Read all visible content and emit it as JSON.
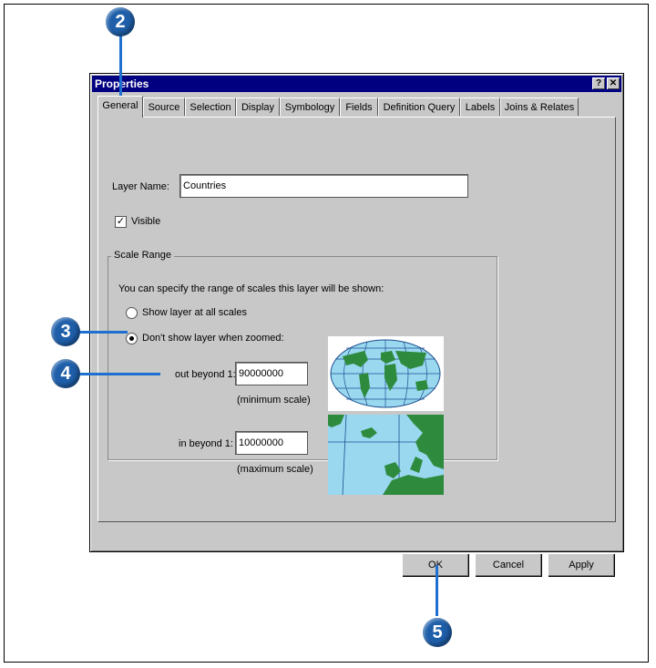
{
  "dialog": {
    "title": "Properties",
    "help_btn": "?",
    "close_btn": "✕"
  },
  "tabs": [
    "General",
    "Source",
    "Selection",
    "Display",
    "Symbology",
    "Fields",
    "Definition Query",
    "Labels",
    "Joins & Relates"
  ],
  "general": {
    "layer_name_label": "Layer Name:",
    "layer_name_value": "Countries",
    "visible_label": "Visible",
    "visible_checked": true,
    "scale_group_title": "Scale Range",
    "scale_desc": "You can specify the range of scales this layer will be shown:",
    "radio_all": "Show layer at all scales",
    "radio_zoomed": "Don't show layer when zoomed:",
    "radio_selected": "radio_zoomed",
    "out_beyond_label": "out beyond 1:",
    "out_beyond_value": "90000000",
    "min_scale_caption": "(minimum scale)",
    "in_beyond_label": "in beyond 1:",
    "in_beyond_value": "10000000",
    "max_scale_caption": "(maximum scale)"
  },
  "buttons": {
    "ok": "OK",
    "cancel": "Cancel",
    "apply": "Apply"
  },
  "callouts": [
    "2",
    "3",
    "4",
    "5"
  ],
  "colors": {
    "callout": "#1f5faa",
    "titlebar": "#000080",
    "ocean": "#9ad8f0",
    "land": "#2e8b3e"
  }
}
